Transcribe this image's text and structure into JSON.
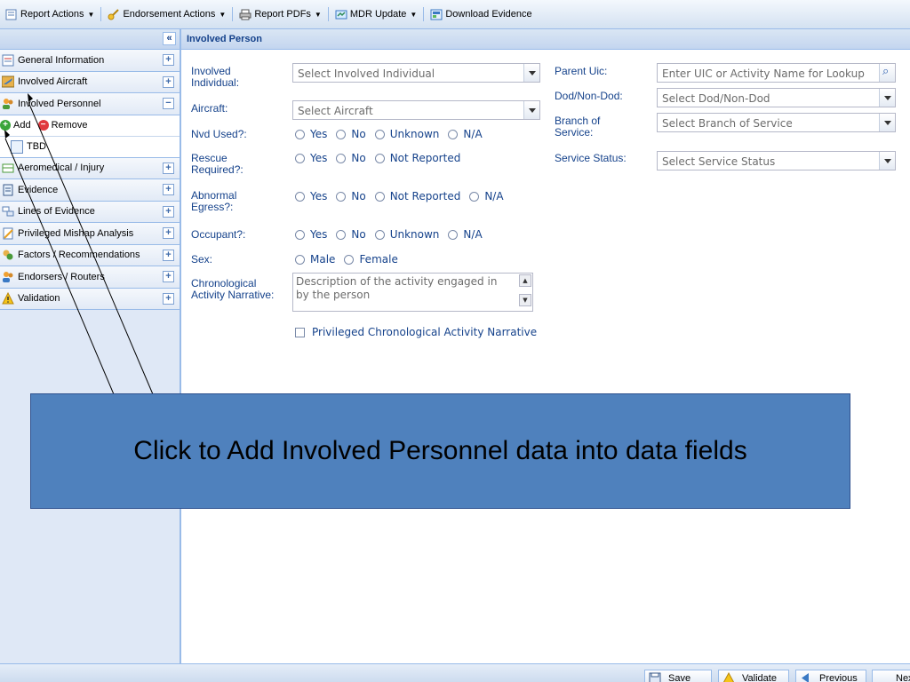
{
  "toolbar": {
    "items": [
      {
        "label": "Report Actions",
        "icon": "report-icon",
        "dropdown": true
      },
      {
        "label": "Endorsement Actions",
        "icon": "key-icon",
        "dropdown": true
      },
      {
        "label": "Report PDFs",
        "icon": "printer-icon",
        "dropdown": true
      },
      {
        "label": "MDR Update",
        "icon": "mdr-icon",
        "dropdown": true
      },
      {
        "label": "Download Evidence",
        "icon": "download-icon",
        "dropdown": false
      }
    ]
  },
  "sidebar": {
    "collapse_glyph": "«",
    "items": [
      {
        "label": "General Information",
        "icon": "form-icon",
        "toggle": "+"
      },
      {
        "label": "Involved Aircraft",
        "icon": "aircraft-icon",
        "toggle": "+"
      },
      {
        "label": "Involved Personnel",
        "icon": "people-icon",
        "toggle": "−"
      }
    ],
    "sub_actions": {
      "add": "Add",
      "remove": "Remove"
    },
    "sub_item": "TBD",
    "items_after": [
      {
        "label": "Aeromedical / Injury",
        "icon": "medical-icon",
        "toggle": "+"
      },
      {
        "label": "Evidence",
        "icon": "evidence-icon",
        "toggle": "+"
      },
      {
        "label": "Lines of Evidence",
        "icon": "lines-icon",
        "toggle": "+"
      },
      {
        "label": "Privileged Mishap Analysis",
        "icon": "analysis-icon",
        "toggle": "+"
      },
      {
        "label": "Factors / Recommendations",
        "icon": "factors-icon",
        "toggle": "+"
      },
      {
        "label": "Endorsers / Routers",
        "icon": "endorsers-icon",
        "toggle": "+"
      },
      {
        "label": "Validation",
        "icon": "warning-icon",
        "toggle": "+"
      }
    ]
  },
  "panel": {
    "title": "Involved Person",
    "labels": {
      "involved_individual_1": "Involved",
      "involved_individual_2": "Individual:",
      "aircraft": "Aircraft:",
      "nvd_used": "Nvd Used?:",
      "rescue_1": "Rescue",
      "rescue_2": "Required?:",
      "abnormal_1": "Abnormal",
      "abnormal_2": "Egress?:",
      "occupant": "Occupant?:",
      "sex": "Sex:",
      "chrono_1": "Chronological",
      "chrono_2": "Activity Narrative:",
      "parent_uic": "Parent Uic:",
      "dod": "Dod/Non-Dod:",
      "branch_1": "Branch of",
      "branch_2": "Service:",
      "service_status": "Service Status:"
    },
    "placeholders": {
      "involved_individual": "Select Involved Individual",
      "aircraft": "Select Aircraft",
      "parent_uic": "Enter UIC or Activity Name for Lookup",
      "dod": "Select Dod/Non-Dod",
      "branch": "Select Branch of Service",
      "service_status": "Select Service Status",
      "narrative": "Description of the activity engaged in by the person"
    },
    "radios": {
      "nvd": [
        "Yes",
        "No",
        "Unknown",
        "N/A"
      ],
      "rescue": [
        "Yes",
        "No",
        "Not Reported"
      ],
      "abnormal": [
        "Yes",
        "No",
        "Not Reported",
        "N/A"
      ],
      "occupant": [
        "Yes",
        "No",
        "Unknown",
        "N/A"
      ],
      "sex": [
        "Male",
        "Female"
      ]
    },
    "privileged_checkbox": "Privileged Chronological Activity Narrative"
  },
  "callout": {
    "text": "Click to Add Involved Personnel data into data fields"
  },
  "bottom": {
    "save": "Save",
    "validate": "Validate",
    "previous": "Previous",
    "next": "Next"
  }
}
